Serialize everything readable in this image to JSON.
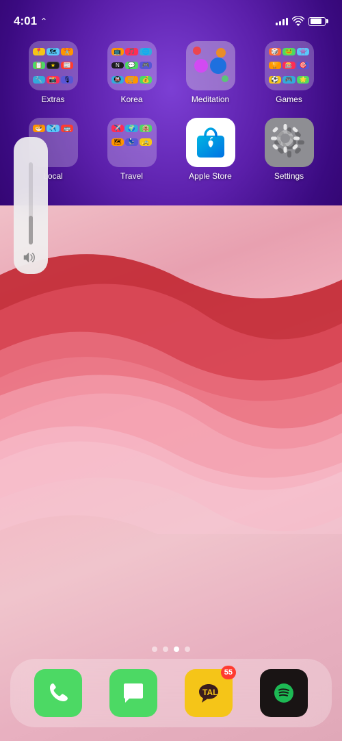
{
  "status_bar": {
    "time": "4:01",
    "signal_bars": [
      3,
      5,
      7,
      9,
      11
    ],
    "battery_level": 80
  },
  "app_rows": [
    {
      "row_id": "row1",
      "apps": [
        {
          "id": "extras",
          "label": "Extras",
          "type": "folder"
        },
        {
          "id": "korea",
          "label": "Korea",
          "type": "folder"
        },
        {
          "id": "meditation",
          "label": "Meditation",
          "type": "folder"
        },
        {
          "id": "games",
          "label": "Games",
          "type": "folder"
        }
      ]
    },
    {
      "row_id": "row2",
      "apps": [
        {
          "id": "local",
          "label": "Local",
          "type": "folder"
        },
        {
          "id": "travel",
          "label": "Travel",
          "type": "folder"
        },
        {
          "id": "apple_store",
          "label": "Apple Store",
          "type": "app"
        },
        {
          "id": "settings",
          "label": "Settings",
          "type": "app"
        }
      ]
    }
  ],
  "volume": {
    "level": 35,
    "icon": "speaker"
  },
  "page_dots": {
    "total": 4,
    "active": 2
  },
  "dock": {
    "apps": [
      {
        "id": "phone",
        "label": "Phone",
        "badge": null
      },
      {
        "id": "messages",
        "label": "Messages",
        "badge": null
      },
      {
        "id": "kakaotalk",
        "label": "KakaoTalk",
        "badge": "55"
      },
      {
        "id": "spotify",
        "label": "Spotify",
        "badge": null
      }
    ]
  }
}
